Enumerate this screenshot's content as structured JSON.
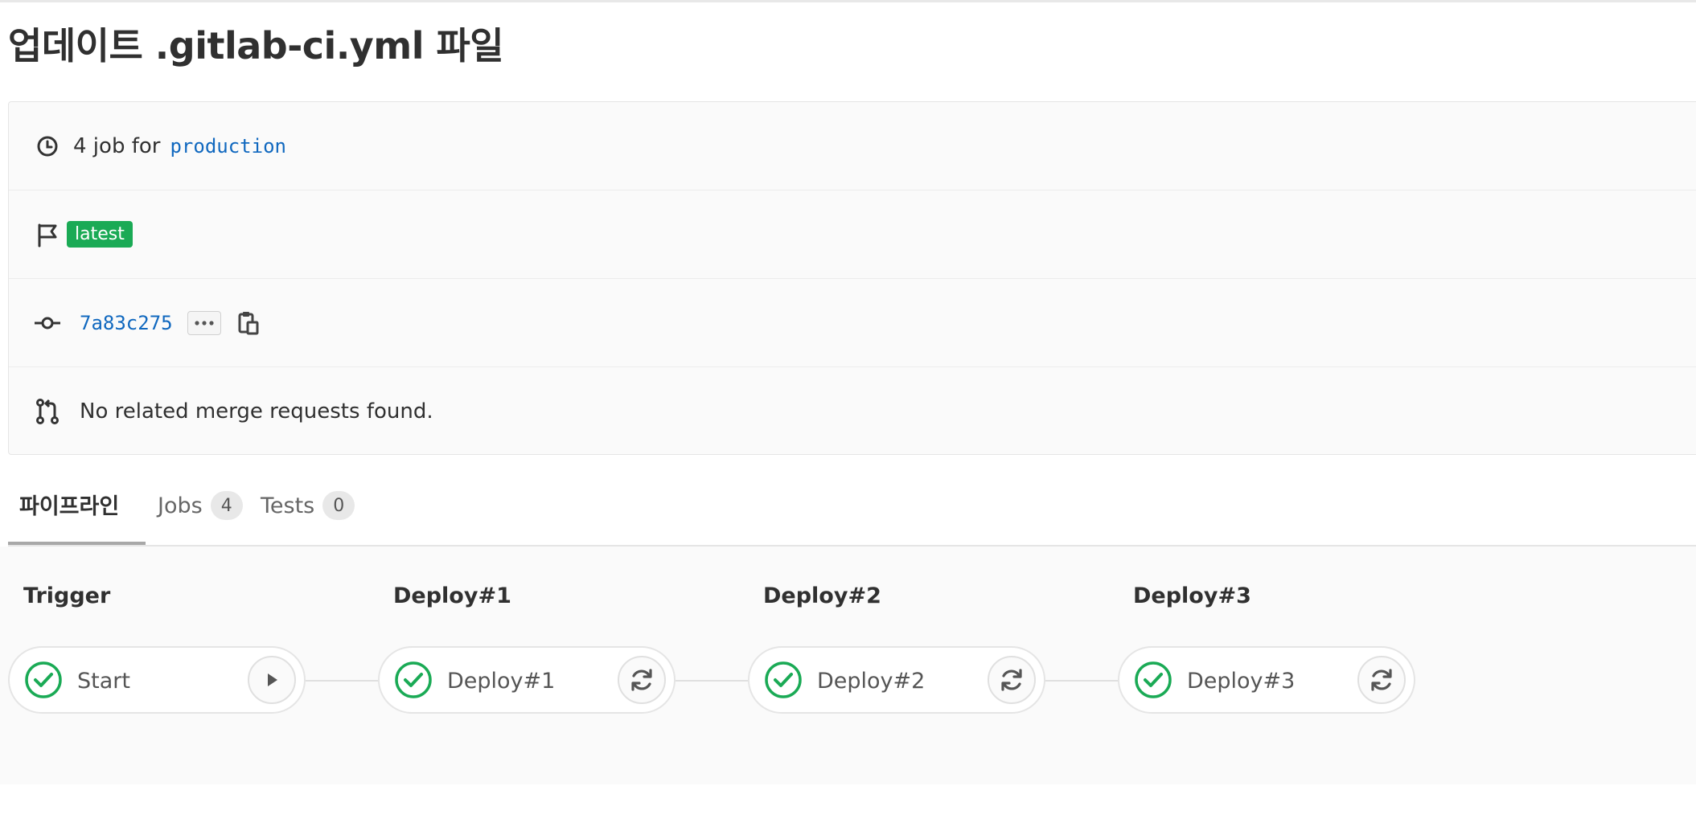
{
  "title": "업데이트 .gitlab-ci.yml 파일",
  "info": {
    "jobs_text": "4 job for",
    "branch": "production",
    "badge": "latest",
    "commit_sha": "7a83c275",
    "merge_text": "No related merge requests found."
  },
  "tabs": [
    {
      "label": "파이프라인",
      "count": null
    },
    {
      "label": "Jobs",
      "count": "4"
    },
    {
      "label": "Tests",
      "count": "0"
    }
  ],
  "stages": [
    {
      "title": "Trigger",
      "job": "Start",
      "status": "success",
      "action": "play-icon"
    },
    {
      "title": "Deploy#1",
      "job": "Deploy#1",
      "status": "success",
      "action": "retry-icon"
    },
    {
      "title": "Deploy#2",
      "job": "Deploy#2",
      "status": "success",
      "action": "retry-icon"
    },
    {
      "title": "Deploy#3",
      "job": "Deploy#3",
      "status": "success",
      "action": "retry-icon"
    }
  ],
  "colors": {
    "success": "#1aaa55",
    "link": "#1068bf",
    "badge": "#1aaa55"
  }
}
